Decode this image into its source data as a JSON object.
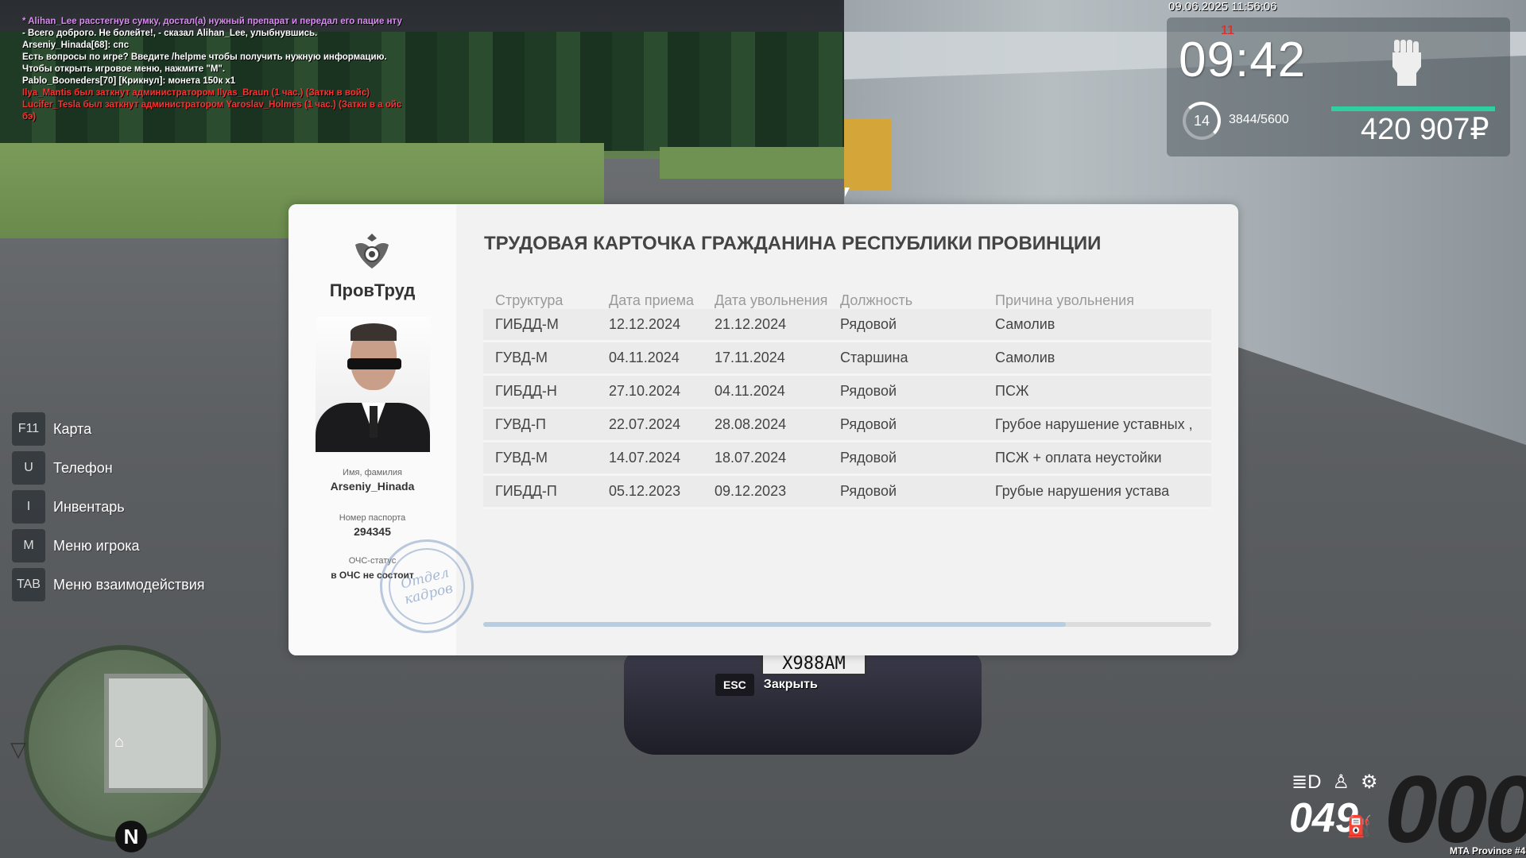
{
  "chat": [
    {
      "text": "* Alihan_Lee расстегнув сумку, достал(а) нужный препарат и передал его пацие нту",
      "color": "#d88cf0"
    },
    {
      "text": "- Всего доброго. Не болейте!, - сказал Alihan_Lee, улыбнувшись.",
      "color": "#ffffff"
    },
    {
      "text": "Arseniy_Hinada[68]: спс",
      "color": "#ffffff"
    },
    {
      "text": "Есть вопросы по игре? Введите /helpme чтобы получить нужную информацию.",
      "color": "#ffffff"
    },
    {
      "text": "Чтобы открыть игровое меню, нажмите \"M\".",
      "color": "#ffffff"
    },
    {
      "text": "Pablo_Booneders[70] [Крикнул]: монета 150к x1",
      "color": "#ffffff"
    },
    {
      "text": "Ilya_Mantis был заткнут администратором Ilyas_Braun (1 час.) (Заткн в войс)",
      "color": "#ff3030"
    },
    {
      "text": "Lucifer_Tesla был заткнут администратором Yaroslav_Holmes (1 час.) (Заткн в а ойс бэ)",
      "color": "#ff3030"
    }
  ],
  "hud": {
    "datetime": "09.06.2025 11:56:06",
    "wanted": "11",
    "clock": "09:42",
    "level": "14",
    "xp": "3844/5600",
    "money": "420 907₽",
    "icons": {
      "status": "fist-icon"
    }
  },
  "hints": [
    {
      "key": "F11",
      "label": "Карта"
    },
    {
      "key": "U",
      "label": "Телефон"
    },
    {
      "key": "I",
      "label": "Инвентарь"
    },
    {
      "key": "M",
      "label": "Меню игрока"
    },
    {
      "key": "TAB",
      "label": "Меню взаимодействия"
    }
  ],
  "minimap": {
    "north": "N"
  },
  "esc": {
    "key": "ESC",
    "label": "Закрыть"
  },
  "vehicle": {
    "plate": "X988AM",
    "fuel": "049",
    "speed": "000",
    "gear": "D"
  },
  "server": "MTA Province #4",
  "card": {
    "title": "ТРУДОВАЯ КАРТОЧКА ГРАЖДАНИНА РЕСПУБЛИКИ ПРОВИНЦИИ",
    "org": "ПровТруд",
    "name_label": "Имя, фамилия",
    "name": "Arseniy_Hinada",
    "passport_label": "Номер паспорта",
    "passport": "294345",
    "ochs_label": "ОЧС-статус",
    "ochs": "в ОЧС не состоит",
    "stamp": "Отдел кадров",
    "columns": [
      "Структура",
      "Дата приема",
      "Дата увольнения",
      "Должность",
      "Причина увольнения"
    ],
    "rows": [
      [
        "ГИБДД-М",
        "12.12.2024",
        "21.12.2024",
        "Рядовой",
        "Самолив"
      ],
      [
        "ГУВД-М",
        "04.11.2024",
        "17.11.2024",
        "Старшина",
        "Самолив"
      ],
      [
        "ГИБДД-Н",
        "27.10.2024",
        "04.11.2024",
        "Рядовой",
        "ПСЖ"
      ],
      [
        "ГУВД-П",
        "22.07.2024",
        "28.08.2024",
        "Рядовой",
        "Грубое нарушение уставных ,"
      ],
      [
        "ГУВД-М",
        "14.07.2024",
        "18.07.2024",
        "Рядовой",
        "ПСЖ + оплата неустойки"
      ],
      [
        "ГИБДД-П",
        "05.12.2023",
        "09.12.2023",
        "Рядовой",
        "Грубые нарушения устава"
      ]
    ],
    "scroll_fraction": 0.8
  }
}
